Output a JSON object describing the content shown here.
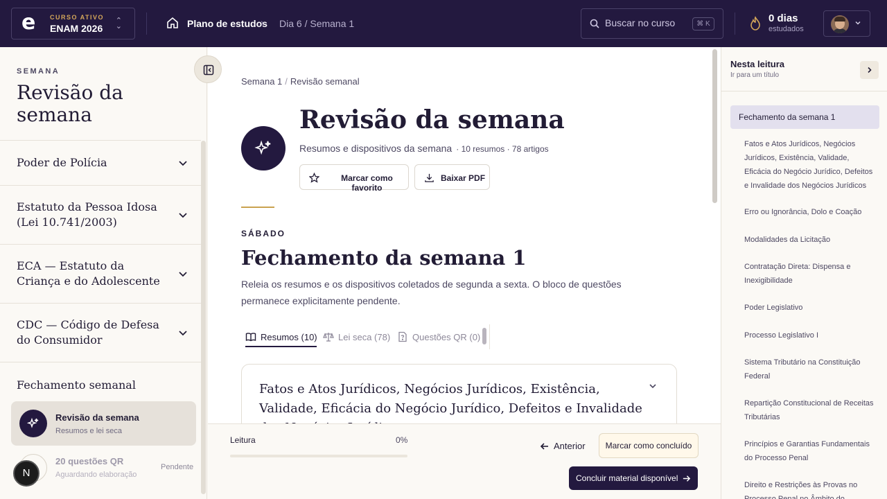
{
  "header": {
    "course_label": "CURSO ATIVO",
    "course_name": "ENAM 2026",
    "logo_letter": "e",
    "breadcrumb_home": "Plano de estudos",
    "breadcrumb_current": "Dia 6 / Semana 1",
    "search_placeholder": "Buscar no curso",
    "search_shortcut": "⌘ K",
    "streak_days": "0 dias",
    "streak_label": "estudados"
  },
  "left": {
    "kicker": "SEMANA",
    "title": "Revisão da semana",
    "accordions": [
      {
        "label": "Poder de Polícia"
      },
      {
        "label": "Estatuto da Pessoa Idosa (Lei 10.741/2003)"
      },
      {
        "label": "ECA — Estatuto da Criança e do Adolescente"
      },
      {
        "label": "CDC — Código de Defesa do Consumidor"
      }
    ],
    "section_title": "Fechamento semanal",
    "items": [
      {
        "title": "Revisão da semana",
        "sub": "Resumos e lei seca"
      },
      {
        "title": "20 questões QR",
        "sub": "Aguardando elaboração",
        "status": "Pendente"
      }
    ],
    "badge": "N"
  },
  "main": {
    "breadcrumb": [
      "Semana 1",
      "Revisão semanal"
    ],
    "title": "Revisão da semana",
    "subtitle": "Resumos e dispositivos da semana",
    "meta": "· 10 resumos · 78 artigos",
    "fav_label": "Marcar como favorito",
    "pdf_label": "Baixar PDF",
    "day_kicker": "SÁBADO",
    "section_title": "Fechamento da semana 1",
    "section_desc": "Releia os resumos e os dispositivos coletados de segunda a sexta. O bloco de questões permanece explicitamente pendente.",
    "tabs": [
      {
        "label": "Resumos (10)"
      },
      {
        "label": "Lei seca (78)"
      },
      {
        "label": "Questões QR (0)"
      }
    ],
    "card_title": "Fatos e Atos Jurídicos, Negócios Jurídicos, Existência, Validade, Eficácia do Negócio Jurídico, Defeitos e Invalidade dos Negócios Jurídicos"
  },
  "footer": {
    "reading_label": "Leitura",
    "reading_percent": "0%",
    "reading_progress": 0,
    "prev_label": "Anterior",
    "done_label": "Marcar como concluído",
    "finish_label": "Concluir material disponível"
  },
  "right": {
    "title": "Nesta leitura",
    "subtitle": "Ir para um título",
    "active": "Fechamento da semana 1",
    "items": [
      "Fatos e Atos Jurídicos, Negócios Jurídicos, Existência, Validade, Eficácia do Negócio Jurídico, Defeitos e Invalidade dos Negócios Jurídicos",
      "Erro ou Ignorância, Dolo e Coação",
      "Modalidades da Licitação",
      "Contratação Direta: Dispensa e Inexigibilidade",
      "Poder Legislativo",
      "Processo Legislativo I",
      "Sistema Tributário na Constituição Federal",
      "Repartição Constitucional de Receitas Tributárias",
      "Princípios e Garantias Fundamentais do Processo Penal",
      "Direito e Restrições às Provas no Processo Penal no Âmbito do"
    ]
  },
  "colors": {
    "brand_dark": "#23193f",
    "accent_gold": "#c9a24f",
    "page_bg": "#fbf9f5",
    "toc_active_bg": "#e3e0ee"
  }
}
